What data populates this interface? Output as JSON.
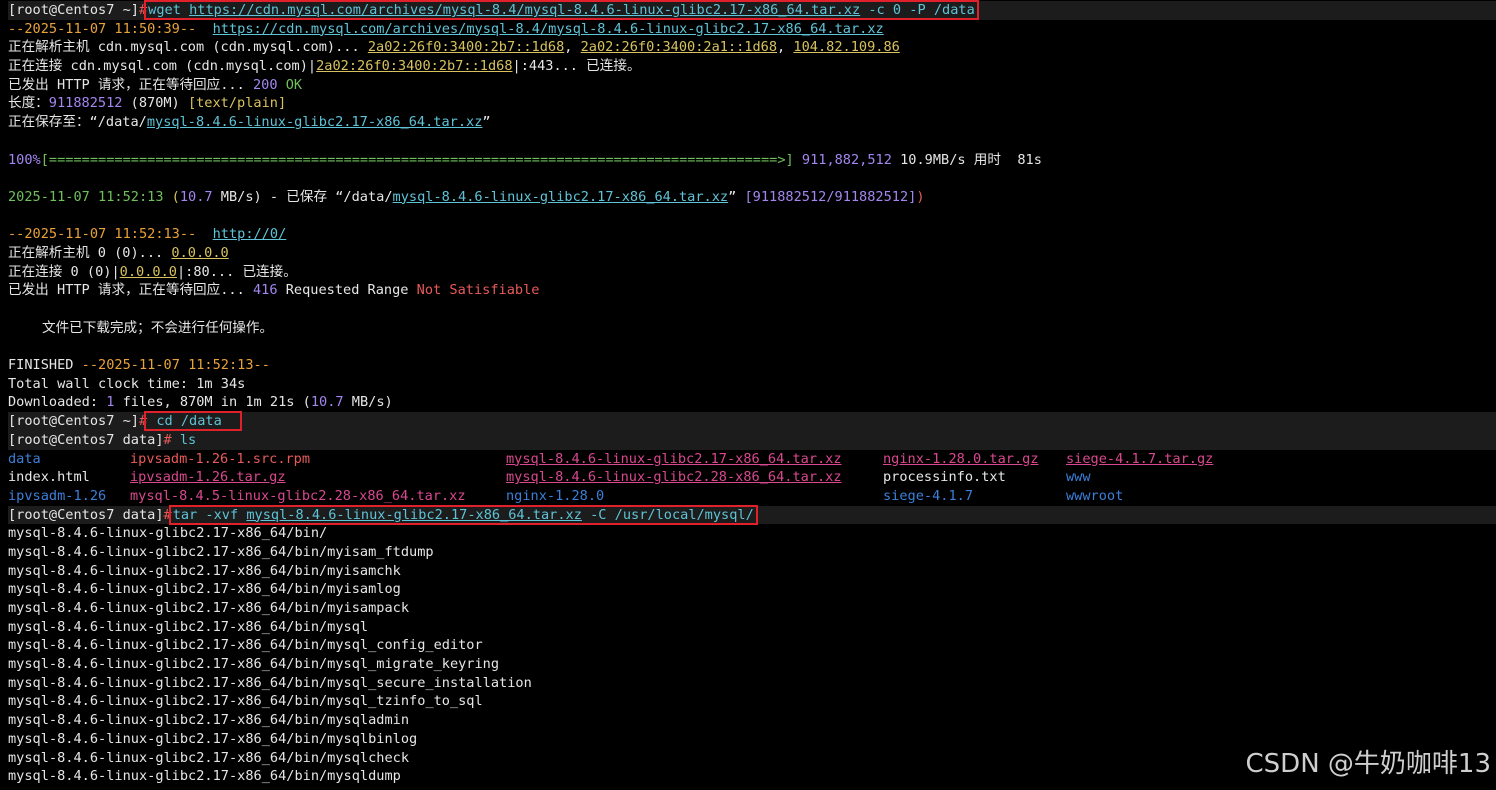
{
  "prompt1": {
    "user": "[root@Centos7 ~]",
    "hash": "#"
  },
  "cmd1": {
    "wget": "wget",
    "url": "https://cdn.mysql.com/archives/mysql-8.4/mysql-8.4.6-linux-glibc2.17-x86_64.tar.xz",
    "opts": " -c 0 -P /data"
  },
  "l2": {
    "ts": "--2025-11-07 11:50:39--",
    "url": "https://cdn.mysql.com/archives/mysql-8.4/mysql-8.4.6-linux-glibc2.17-x86_64.tar.xz"
  },
  "l3": {
    "a": "正在解析主机 cdn.mysql.com (cdn.mysql.com)... ",
    "ip1": "2a02:26f0:3400:2b7::1d68",
    "sep1": ", ",
    "ip2": "2a02:26f0:3400:2a1::1d68",
    "sep2": ", ",
    "ip3": "104.82.109.86"
  },
  "l4": {
    "a": "正在连接 cdn.mysql.com (cdn.mysql.com)|",
    "ip": "2a02:26f0:3400:2b7::1d68",
    "b": "|:443",
    "c": "... 已连接。"
  },
  "l5": {
    "a": "已发出 HTTP 请求，正在等待回应... ",
    "code": "200",
    "ok": " OK"
  },
  "l6": {
    "a": "长度：",
    "len": "911882512",
    "b": " (870M) ",
    "type": "[text/plain]"
  },
  "l7": {
    "a": "正在保存至：“/data/",
    "file": "mysql-8.4.6-linux-glibc2.17-x86_64.tar.xz",
    "b": "”"
  },
  "progress": {
    "pct": "100%",
    "bar": "[=========================================================================================>]",
    "bytes": " 911,882,512",
    "rate": " 10.9MB/s ",
    "label": "用时",
    "time": "  81s"
  },
  "saved": {
    "ts": "2025-11-07 11:52:13",
    "rate_open": " (",
    "rate": "10.7",
    "rate_unit": " MB/s)",
    "mid": " - 已保存 “/data/",
    "file": "mysql-8.4.6-linux-glibc2.17-x86_64.tar.xz",
    "end": "” ",
    "counts": "[911882512/911882512]",
    "close": ")"
  },
  "l10": {
    "ts": "--2025-11-07 11:52:13--",
    "url": "http://0/"
  },
  "l11": {
    "a": "正在解析主机 0 (0)... ",
    "ip": "0.0.0.0"
  },
  "l12": {
    "a": "正在连接 0 (0)|",
    "ip": "0.0.0.0",
    "b": "|:80",
    "c": "... 已连接。"
  },
  "l13": {
    "a": "已发出 HTTP 请求，正在等待回应... ",
    "code": "416",
    "b": " Requested Range ",
    "c": "Not Satisfiable"
  },
  "l14": {
    "text": "文件已下载完成；不会进行任何操作。"
  },
  "finished": {
    "label": "FINISHED ",
    "ts": "--2025-11-07 11:52:13--"
  },
  "wall": {
    "label": "Total wall clock time: ",
    "value": "1m 34s"
  },
  "downloaded": {
    "label": "Downloaded: ",
    "n": "1",
    "files": " files, 870M in 1m 21s (",
    "rate": "10.7",
    "unit": " MB/s)"
  },
  "prompt2": {
    "user": "[root@Centos7 ~]",
    "hash": "#",
    "cmd": " cd /data"
  },
  "prompt3": {
    "user": "[root@Centos7 data]",
    "hash": "#",
    "cmd": " ls"
  },
  "ls": {
    "row1": [
      "data",
      "ipvsadm-1.26-1.src.rpm",
      "mysql-8.4.6-linux-glibc2.17-x86_64.tar.xz",
      "nginx-1.28.0.tar.gz",
      "siege-4.1.7.tar.gz"
    ],
    "row2": [
      "index.html",
      "ipvsadm-1.26.tar.gz",
      "mysql-8.4.6-linux-glibc2.28-x86_64.tar.xz",
      "processinfo.txt",
      "www"
    ],
    "row3": [
      "ipvsadm-1.26",
      "mysql-8.4.5-linux-glibc2.28-x86_64.tar.xz",
      "nginx-1.28.0",
      "siege-4.1.7",
      "wwwroot"
    ]
  },
  "prompt4": {
    "user": "[root@Centos7 data]",
    "hash": "#",
    "tar": "tar -xvf ",
    "file": "mysql-8.4.6-linux-glibc2.17-x86_64.tar.xz",
    "opts": " -C /usr/local/mysql/"
  },
  "tar_output": [
    "mysql-8.4.6-linux-glibc2.17-x86_64/bin/",
    "mysql-8.4.6-linux-glibc2.17-x86_64/bin/myisam_ftdump",
    "mysql-8.4.6-linux-glibc2.17-x86_64/bin/myisamchk",
    "mysql-8.4.6-linux-glibc2.17-x86_64/bin/myisamlog",
    "mysql-8.4.6-linux-glibc2.17-x86_64/bin/myisampack",
    "mysql-8.4.6-linux-glibc2.17-x86_64/bin/mysql",
    "mysql-8.4.6-linux-glibc2.17-x86_64/bin/mysql_config_editor",
    "mysql-8.4.6-linux-glibc2.17-x86_64/bin/mysql_migrate_keyring",
    "mysql-8.4.6-linux-glibc2.17-x86_64/bin/mysql_secure_installation",
    "mysql-8.4.6-linux-glibc2.17-x86_64/bin/mysql_tzinfo_to_sql",
    "mysql-8.4.6-linux-glibc2.17-x86_64/bin/mysqladmin",
    "mysql-8.4.6-linux-glibc2.17-x86_64/bin/mysqlbinlog",
    "mysql-8.4.6-linux-glibc2.17-x86_64/bin/mysqlcheck",
    "mysql-8.4.6-linux-glibc2.17-x86_64/bin/mysqldump"
  ],
  "watermark": "CSDN @牛奶咖啡13"
}
